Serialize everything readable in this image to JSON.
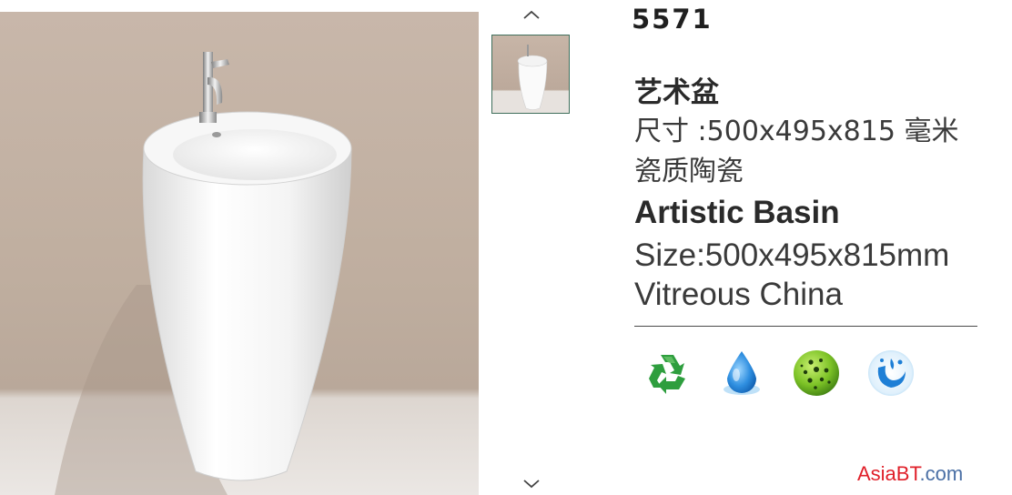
{
  "gallery": {
    "main_image": "artistic-basin-photo",
    "thumbnails": [
      {
        "name": "artistic-basin-thumbnail",
        "selected": true
      }
    ],
    "prev_icon": "chevron-up-icon",
    "next_icon": "chevron-down-icon"
  },
  "product": {
    "model": "5571",
    "name_zh": "艺术盆",
    "size_zh": "尺寸 :500x495x815 毫米",
    "material_zh": "瓷质陶瓷",
    "name_en": "Artistic Basin",
    "size_en": "Size:500x495x815mm",
    "material_en": "Vitreous China"
  },
  "features": [
    {
      "icon": "recycle-icon"
    },
    {
      "icon": "water-drop-icon"
    },
    {
      "icon": "antibacterial-icon"
    },
    {
      "icon": "water-splash-icon"
    }
  ],
  "brand": {
    "part1": "AsiaBT",
    "part2": ".com",
    "colors": {
      "part1": "#e0202a",
      "part2": "#4a6fa5"
    }
  }
}
